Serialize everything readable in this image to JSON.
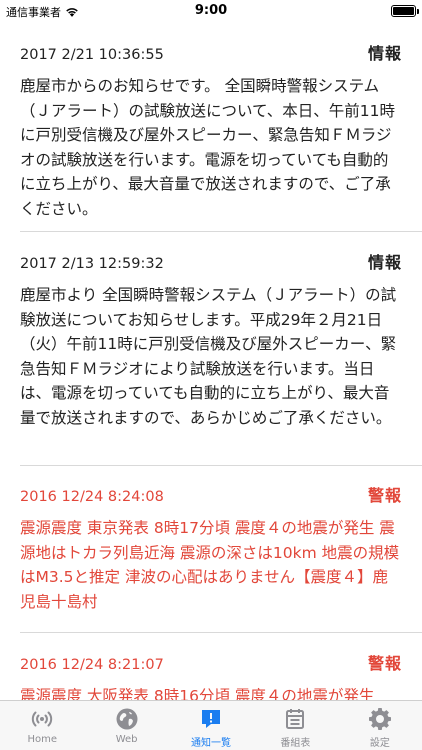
{
  "status_bar": {
    "carrier": "通信事業者",
    "time": "9:00",
    "battery_level": 1.0
  },
  "notifications": [
    {
      "date": "2017 2/21 10:36:55",
      "type": "情報",
      "body": "鹿屋市からのお知らせです。 全国瞬時警報システム（Ｊアラート）の試験放送について、本日、午前11時に戸別受信機及び屋外スピーカー、緊急告知ＦＭラジオの試験放送を行います。電源を切っていても自動的に立ち上がり、最大音量で放送されますので、ご了承ください。"
    },
    {
      "date": "2017 2/13 12:59:32",
      "type": "情報",
      "body": "鹿屋市より 全国瞬時警報システム（Ｊアラート）の試験放送についてお知らせします。平成29年２月21日（火）午前11時に戸別受信機及び屋外スピーカー、緊急告知ＦＭラジオにより試験放送を行います。当日は、電源を切っていても自動的に立ち上がり、最大音量で放送されますので、あらかじめご了承ください。"
    },
    {
      "date": "2016 12/24 8:24:08",
      "type": "警報",
      "body": "震源震度 東京発表 8時17分頃 震度４の地震が発生 震源地はトカラ列島近海 震源の深さは10km 地震の規模はM3.5と推定 津波の心配はありません【震度４】鹿児島十島村"
    },
    {
      "date": "2016 12/24 8:21:07",
      "type": "警報",
      "body": "震源震度 大阪発表 8時16分頃 震度４の地震が発生"
    }
  ],
  "tabs": [
    {
      "label": "Home",
      "icon": "broadcast-icon"
    },
    {
      "label": "Web",
      "icon": "globe-icon"
    },
    {
      "label": "通知一覧",
      "icon": "alert-bubble-icon"
    },
    {
      "label": "番組表",
      "icon": "schedule-icon"
    },
    {
      "label": "設定",
      "icon": "gear-icon"
    }
  ],
  "colors": {
    "alert": "#e2473a",
    "active_tab": "#1a7df0",
    "inactive_tab": "#8e8e93"
  }
}
